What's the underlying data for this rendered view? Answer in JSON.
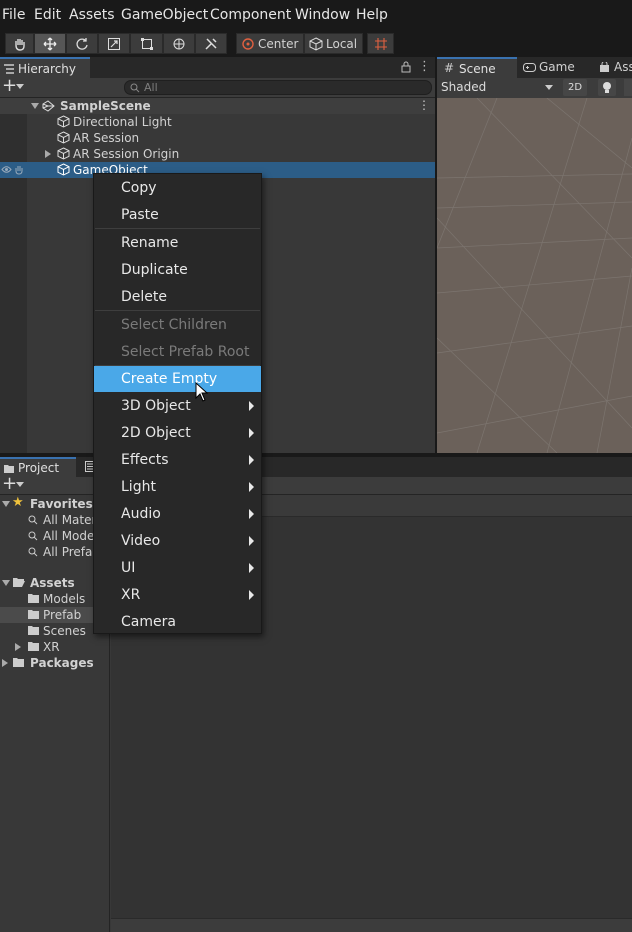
{
  "menubar": [
    "File",
    "Edit",
    "Assets",
    "GameObject",
    "Component",
    "Window",
    "Help"
  ],
  "toolbar": {
    "pivot": "Center",
    "space": "Local"
  },
  "hierarchy": {
    "tab": "Hierarchy",
    "search_placeholder": "All",
    "scene": "SampleScene",
    "items": [
      "Directional Light",
      "AR Session",
      "AR Session Origin",
      "GameObject"
    ]
  },
  "scene": {
    "tabs": [
      "Scene",
      "Game",
      "Ass"
    ],
    "shading": "Shaded",
    "mode_2d": "2D"
  },
  "project": {
    "tabs": [
      "Project"
    ],
    "favorites_label": "Favorites",
    "favorites": [
      "All Materials",
      "All Models",
      "All Prefabs"
    ],
    "assets_label": "Assets",
    "assets": [
      "Models",
      "Prefab",
      "Scenes",
      "XR"
    ],
    "packages_label": "Packages"
  },
  "context_menu": {
    "items": [
      "Copy",
      "Paste",
      "Rename",
      "Duplicate",
      "Delete",
      "Select Children",
      "Select Prefab Root",
      "Create Empty",
      "3D Object",
      "2D Object",
      "Effects",
      "Light",
      "Audio",
      "Video",
      "UI",
      "XR",
      "Camera"
    ],
    "highlighted": "Create Empty",
    "disabled": [
      "Select Children",
      "Select Prefab Root"
    ],
    "submenus": [
      "3D Object",
      "2D Object",
      "Effects",
      "Light",
      "Audio",
      "Video",
      "UI",
      "XR"
    ]
  },
  "colors": {
    "highlight": "#4aa8e8",
    "selection": "#2c5d87",
    "tab_accent": "#3a72b0",
    "favorite_star": "#f0c23c"
  }
}
